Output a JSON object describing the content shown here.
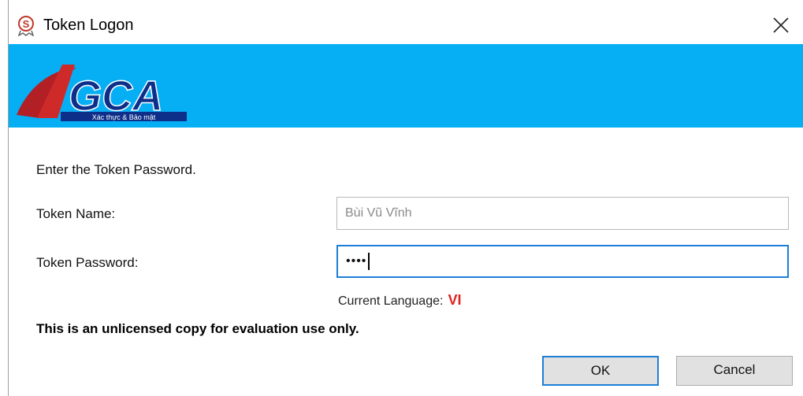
{
  "window": {
    "title": "Token Logon",
    "icon": "app-s-icon",
    "close_icon": "close-icon"
  },
  "banner": {
    "brand_color": "#06aef4",
    "logo_text": "VGCA",
    "logo_tagline": "Xác thực & Bảo mật"
  },
  "form": {
    "instruction": "Enter the Token Password.",
    "token_name_label": "Token Name:",
    "token_name_value": "Bùi Vũ Vĩnh",
    "token_password_label": "Token Password:",
    "token_password_value": "••••",
    "language_label": "Current Language:",
    "language_value": "VI"
  },
  "notice": "This is an unlicensed copy for evaluation use only.",
  "buttons": {
    "ok_label": "OK",
    "cancel_label": "Cancel"
  },
  "colors": {
    "accent": "#1c7ed6",
    "language_value": "#e02020"
  }
}
